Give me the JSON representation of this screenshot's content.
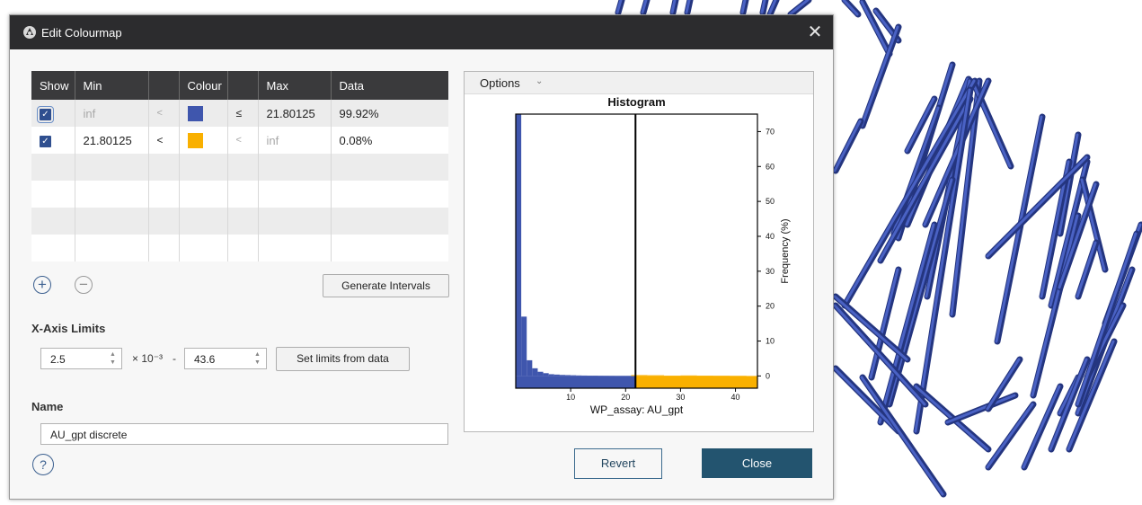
{
  "dialog": {
    "title": "Edit Colourmap",
    "close_glyph": "✕"
  },
  "table": {
    "headers": [
      "Show",
      "Min",
      "",
      "Colour",
      "",
      "Max",
      "Data"
    ],
    "rows": [
      {
        "checked": true,
        "min": "inf",
        "op1": "<",
        "colour": "#3f56ad",
        "op2": "≤",
        "max": "21.80125",
        "data": "99.92%"
      },
      {
        "checked": true,
        "min": "21.80125",
        "op1": "<",
        "colour": "#f9b000",
        "op2": "<",
        "max": "inf",
        "data": "0.08%"
      }
    ],
    "empty_rows": 4
  },
  "buttons": {
    "add_icon": "plus-circle-icon",
    "remove_icon": "minus-circle-icon",
    "add_glyph": "+",
    "remove_glyph": "−",
    "generate_intervals": "Generate Intervals",
    "set_limits": "Set limits from data",
    "revert": "Revert",
    "close": "Close",
    "help": "?"
  },
  "xaxis_limits": {
    "label": "X-Axis Limits",
    "min_value": "2.5",
    "multiplier": "× 10⁻³",
    "separator": "-",
    "max_value": "43.6"
  },
  "name_field": {
    "label": "Name",
    "value": "AU_gpt discrete"
  },
  "histogram": {
    "options_label": "Options",
    "options_caret": "⌄",
    "colors": {
      "low": "#3f56ad",
      "high": "#f9b000"
    },
    "chart_data": {
      "type": "bar",
      "title": "Histogram",
      "xlabel": "WP_assay: AU_gpt",
      "ylabel": "Frequency (%)",
      "xlim": [
        0,
        44
      ],
      "ylim": [
        -3.5,
        75
      ],
      "xticks": [
        10,
        20,
        30,
        40
      ],
      "yticks": [
        0,
        10,
        20,
        30,
        40,
        50,
        60,
        70
      ],
      "threshold": 21.80125,
      "bin_width": 1,
      "bins_x": [
        0.5,
        1.5,
        2.5,
        3.5,
        4.5,
        5.5,
        6.5,
        7.5,
        8.5,
        9.5,
        10.5,
        11.5,
        12.5,
        13.5,
        14.5,
        15.5,
        16.5,
        17.5,
        18.5,
        19.5,
        20.5
      ],
      "bins_freq": [
        75,
        17,
        4.5,
        2.2,
        1.2,
        0.8,
        0.5,
        0.4,
        0.3,
        0.25,
        0.2,
        0.15,
        0.12,
        0.1,
        0.1,
        0.08,
        0.07,
        0.06,
        0.05,
        0.05,
        0.05
      ],
      "high_bins_x": [
        22.5,
        25.5,
        28.5,
        31.5,
        34.5,
        37.5,
        40.5
      ],
      "high_bins_freq": [
        0.25,
        0.2,
        0.1,
        0.15,
        0.1,
        0.08,
        0.05
      ]
    }
  }
}
